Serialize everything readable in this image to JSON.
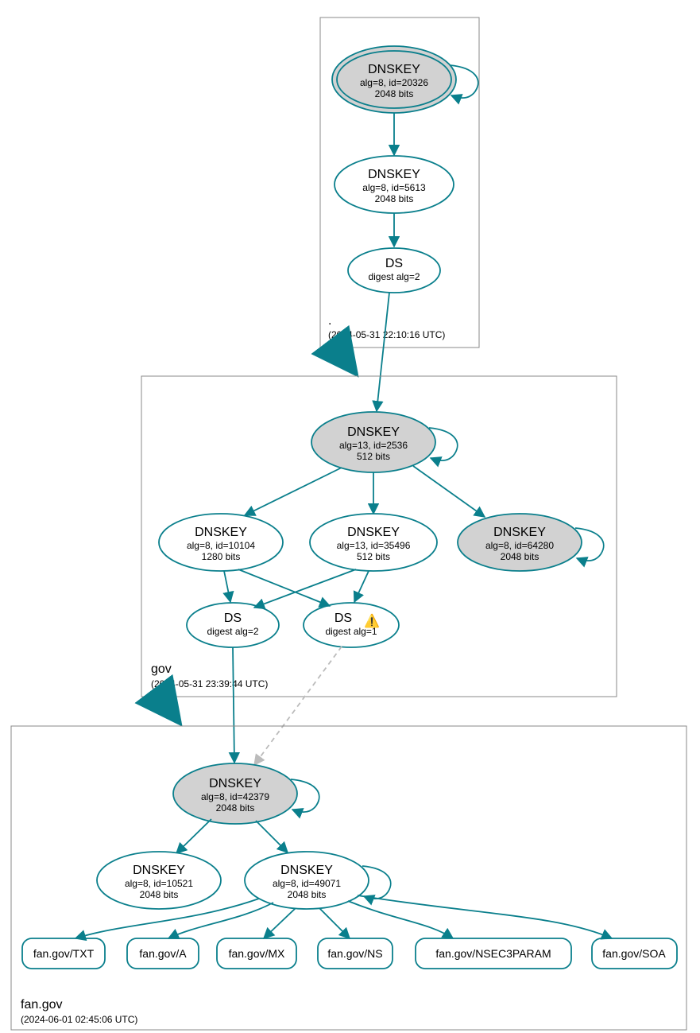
{
  "zones": {
    "root": {
      "label": ".",
      "timestamp": "(2024-05-31 22:10:16 UTC)"
    },
    "gov": {
      "label": "gov",
      "timestamp": "(2024-05-31 23:39:44 UTC)"
    },
    "fan": {
      "label": "fan.gov",
      "timestamp": "(2024-06-01 02:45:06 UTC)"
    }
  },
  "nodes": {
    "root_ksk": {
      "title": "DNSKEY",
      "l1": "alg=8, id=20326",
      "l2": "2048 bits"
    },
    "root_zsk": {
      "title": "DNSKEY",
      "l1": "alg=8, id=5613",
      "l2": "2048 bits"
    },
    "root_ds": {
      "title": "DS",
      "l1": "digest alg=2"
    },
    "gov_ksk": {
      "title": "DNSKEY",
      "l1": "alg=13, id=2536",
      "l2": "512 bits"
    },
    "gov_k2": {
      "title": "DNSKEY",
      "l1": "alg=8, id=10104",
      "l2": "1280 bits"
    },
    "gov_k3": {
      "title": "DNSKEY",
      "l1": "alg=13, id=35496",
      "l2": "512 bits"
    },
    "gov_k4": {
      "title": "DNSKEY",
      "l1": "alg=8, id=64280",
      "l2": "2048 bits"
    },
    "gov_ds1": {
      "title": "DS",
      "l1": "digest alg=2"
    },
    "gov_ds2": {
      "title": "DS",
      "l1": "digest alg=1"
    },
    "fan_ksk": {
      "title": "DNSKEY",
      "l1": "alg=8, id=42379",
      "l2": "2048 bits"
    },
    "fan_k2": {
      "title": "DNSKEY",
      "l1": "alg=8, id=10521",
      "l2": "2048 bits"
    },
    "fan_k3": {
      "title": "DNSKEY",
      "l1": "alg=8, id=49071",
      "l2": "2048 bits"
    },
    "rec_txt": {
      "label": "fan.gov/TXT"
    },
    "rec_a": {
      "label": "fan.gov/A"
    },
    "rec_mx": {
      "label": "fan.gov/MX"
    },
    "rec_ns": {
      "label": "fan.gov/NS"
    },
    "rec_nsec": {
      "label": "fan.gov/NSEC3PARAM"
    },
    "rec_soa": {
      "label": "fan.gov/SOA"
    }
  },
  "warn_icon": "⚠️"
}
